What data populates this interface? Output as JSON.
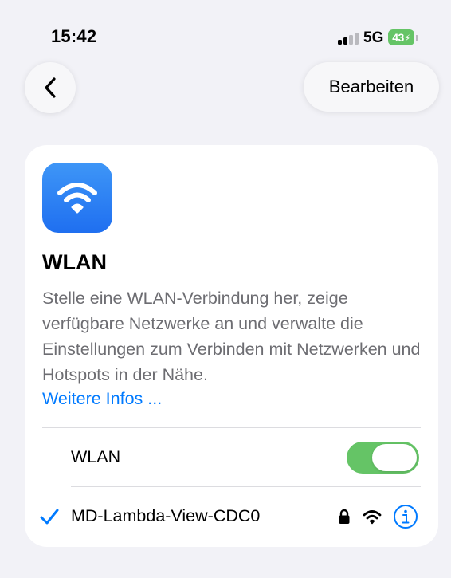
{
  "status_bar": {
    "time": "15:42",
    "network": "5G",
    "battery": "43"
  },
  "nav": {
    "back_icon": "chevron-left-icon",
    "edit_label": "Bearbeiten"
  },
  "card": {
    "icon": "wifi-icon",
    "title": "WLAN",
    "description": "Stelle eine WLAN-Verbindung her, zeige verfügbare Netzwerke an und verwalte die Einstellungen zum Verbinden mit Netzwerken und Hotspots in der Nähe.",
    "learn_more": "Weitere Infos ...",
    "toggle_row": {
      "label": "WLAN",
      "on": true
    },
    "network_row": {
      "name": "MD-Lambda-View-CDC0",
      "connected": true,
      "icons": [
        "lock-icon",
        "wifi-icon",
        "info-icon"
      ]
    }
  },
  "colors": {
    "background": "#f2f2f7",
    "accent_blue": "#007aff",
    "toggle_green": "#65c466",
    "secondary_text": "#6d6d72"
  }
}
